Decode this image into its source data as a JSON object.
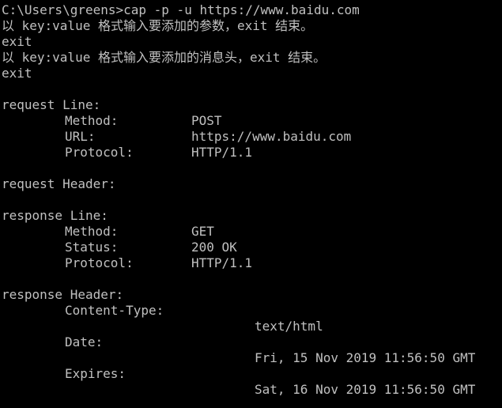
{
  "terminal": {
    "prompt": "C:\\Users\\greens>cap -p -u https://www.baidu.com",
    "param_prompt": "以 key:value 格式输入要添加的参数，exit 结束。",
    "param_input": "exit",
    "header_prompt": "以 key:value 格式输入要添加的消息头，exit 结束。",
    "header_input": "exit"
  },
  "request_line": {
    "title": "request Line:",
    "rows": [
      {
        "key": "Method:",
        "value": "POST"
      },
      {
        "key": "URL:",
        "value": "https://www.baidu.com"
      },
      {
        "key": "Protocol:",
        "value": "HTTP/1.1"
      }
    ]
  },
  "request_header": {
    "title": "request Header:"
  },
  "response_line": {
    "title": "response Line:",
    "rows": [
      {
        "key": "Method:",
        "value": "GET"
      },
      {
        "key": "Status:",
        "value": "200 OK"
      },
      {
        "key": "Protocol:",
        "value": "HTTP/1.1"
      }
    ]
  },
  "response_header": {
    "title": "response Header:",
    "items": [
      {
        "key": "Content-Type:",
        "value": "text/html"
      },
      {
        "key": "Date:",
        "value": "Fri, 15 Nov 2019 11:56:50 GMT"
      },
      {
        "key": "Expires:",
        "value": "Sat, 16 Nov 2019 11:56:50 GMT"
      }
    ]
  },
  "colors": {
    "background": "#000000",
    "text": "#c0c0c0"
  }
}
